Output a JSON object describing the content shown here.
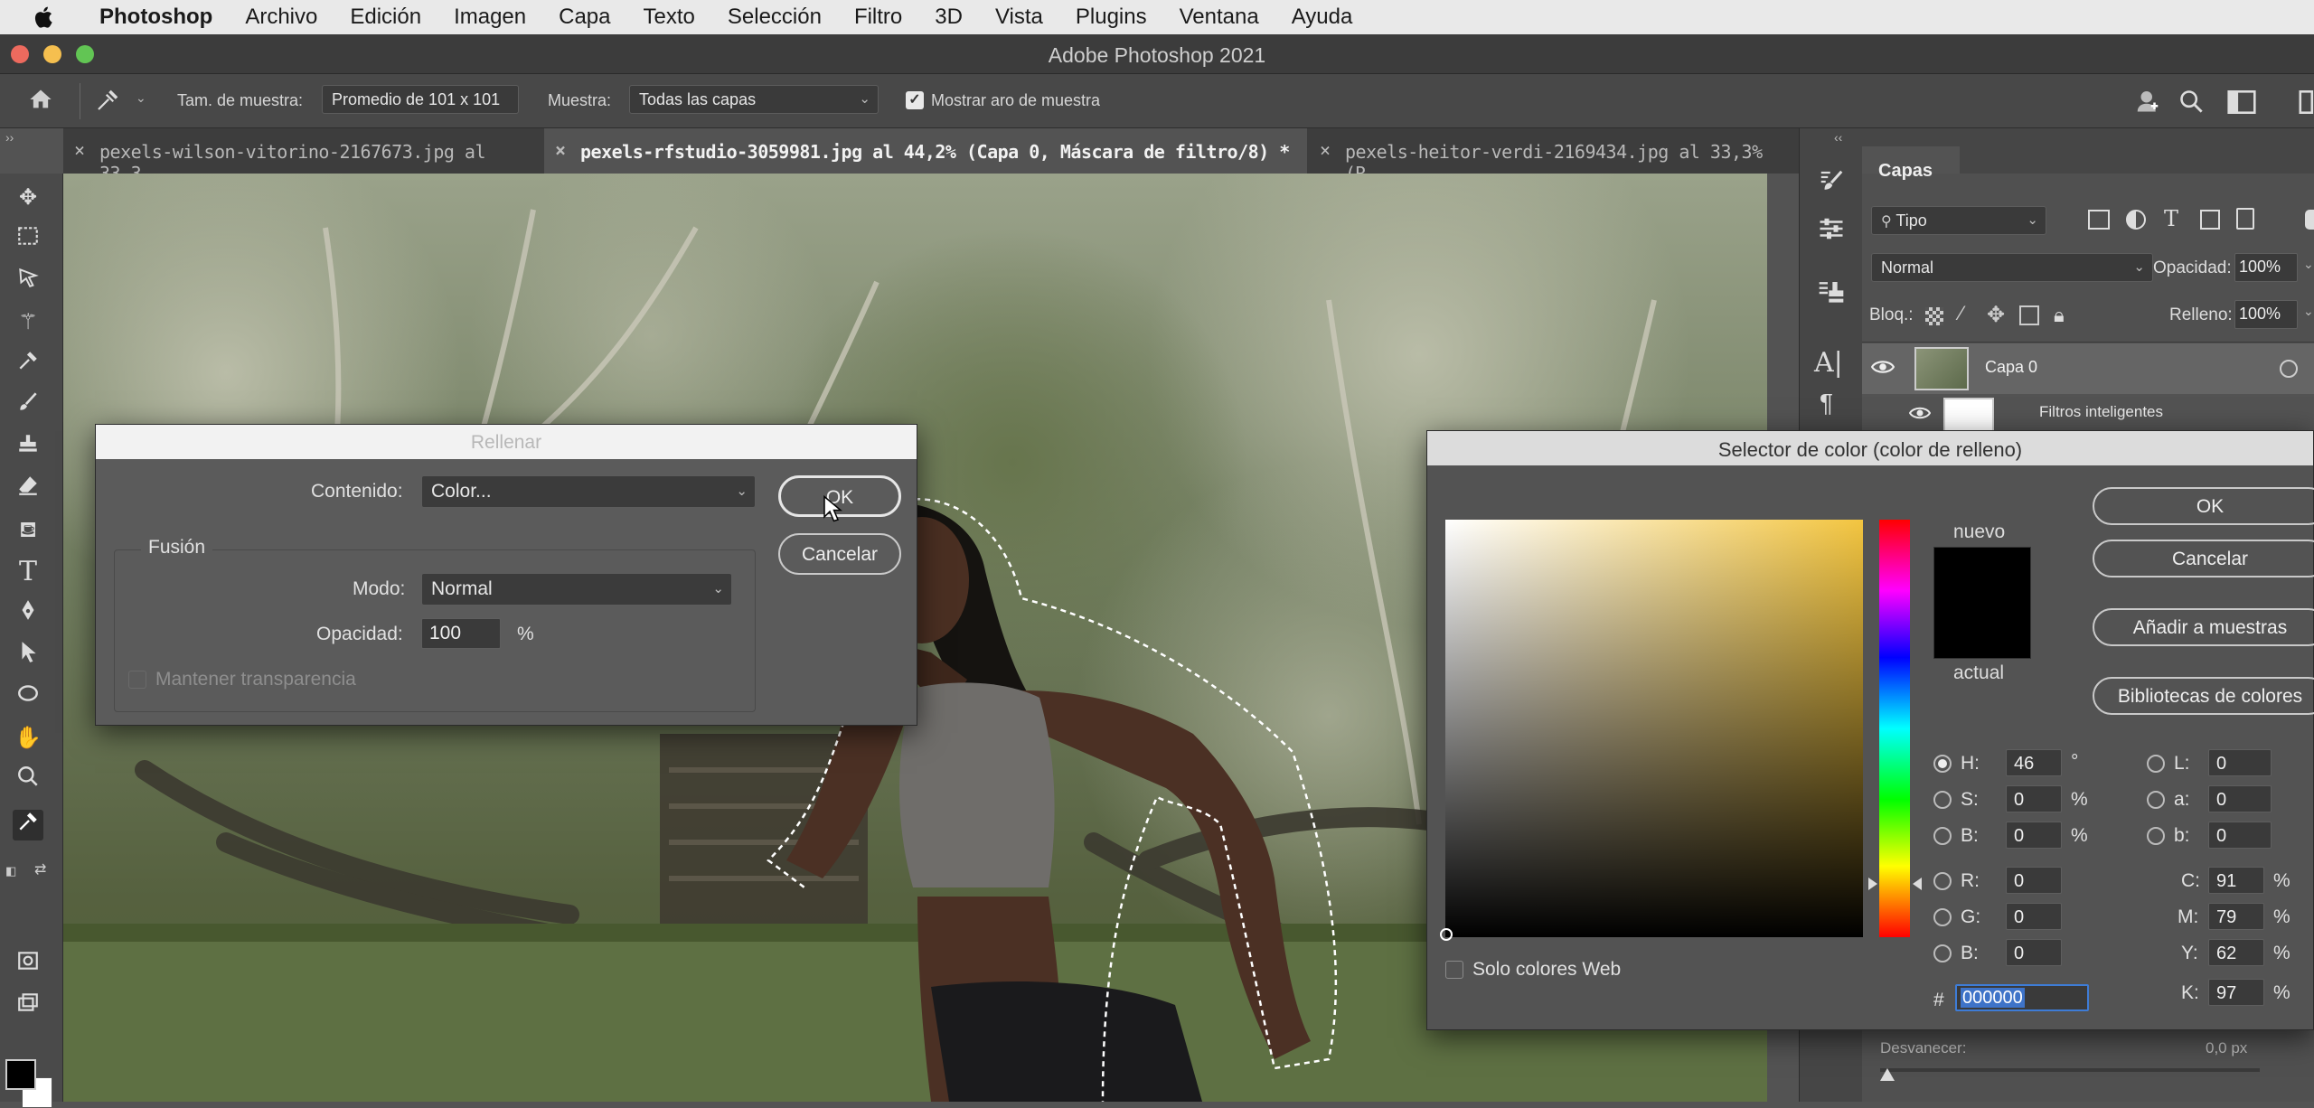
{
  "menubar": {
    "items": [
      "Photoshop",
      "Archivo",
      "Edición",
      "Imagen",
      "Capa",
      "Texto",
      "Selección",
      "Filtro",
      "3D",
      "Vista",
      "Plugins",
      "Ventana",
      "Ayuda"
    ]
  },
  "window": {
    "title": "Adobe Photoshop 2021"
  },
  "options": {
    "sample_size_label": "Tam. de muestra:",
    "sample_size_value": "Promedio de 101 x 101",
    "sample_label": "Muestra:",
    "sample_value": "Todas las capas",
    "show_ring_label": "Mostrar aro de muestra",
    "show_ring_checked": true
  },
  "tabs": [
    {
      "label": "pexels-wilson-vitorino-2167673.jpg al 33,3..."
    },
    {
      "label": "pexels-rfstudio-3059981.jpg al 44,2% (Capa 0, Máscara de filtro/8) *"
    },
    {
      "label": "pexels-heitor-verdi-2169434.jpg al 33,3% (R..."
    }
  ],
  "layers_panel": {
    "title": "Capas",
    "filter": "Tipo",
    "blend_mode": "Normal",
    "opacity_label": "Opacidad:",
    "opacity_value": "100%",
    "lock_label": "Bloq.:",
    "fill_label": "Relleno:",
    "fill_value": "100%",
    "layers": [
      {
        "name": "Capa 0"
      },
      {
        "name": "Filtros inteligentes"
      }
    ],
    "fade_label": "Desvanecer:",
    "fade_value": "0,0 px"
  },
  "fill_dialog": {
    "title": "Rellenar",
    "content_label": "Contenido:",
    "content_value": "Color...",
    "ok": "OK",
    "cancel": "Cancelar",
    "blend_group": "Fusión",
    "mode_label": "Modo:",
    "mode_value": "Normal",
    "opacity_label": "Opacidad:",
    "opacity_value": "100",
    "opacity_unit": "%",
    "preserve_label": "Mantener transparencia"
  },
  "color_picker": {
    "title": "Selector de color (color de relleno)",
    "ok": "OK",
    "cancel": "Cancelar",
    "add_swatches": "Añadir a muestras",
    "libraries": "Bibliotecas de colores",
    "new_label": "nuevo",
    "current_label": "actual",
    "web_only_label": "Solo colores Web",
    "hue_color": "#f3c540",
    "new_color": "#000000",
    "fields": {
      "H": {
        "label": "H:",
        "value": "46",
        "unit": "°"
      },
      "S": {
        "label": "S:",
        "value": "0",
        "unit": "%"
      },
      "Bv": {
        "label": "B:",
        "value": "0",
        "unit": "%"
      },
      "R": {
        "label": "R:",
        "value": "0"
      },
      "G": {
        "label": "G:",
        "value": "0"
      },
      "B": {
        "label": "B:",
        "value": "0"
      },
      "L": {
        "label": "L:",
        "value": "0"
      },
      "a": {
        "label": "a:",
        "value": "0"
      },
      "b": {
        "label": "b:",
        "value": "0"
      },
      "C": {
        "label": "C:",
        "value": "91",
        "unit": "%"
      },
      "M": {
        "label": "M:",
        "value": "79",
        "unit": "%"
      },
      "Y": {
        "label": "Y:",
        "value": "62",
        "unit": "%"
      },
      "K": {
        "label": "K:",
        "value": "97",
        "unit": "%"
      }
    },
    "hex_label": "#",
    "hex_value": "000000"
  }
}
